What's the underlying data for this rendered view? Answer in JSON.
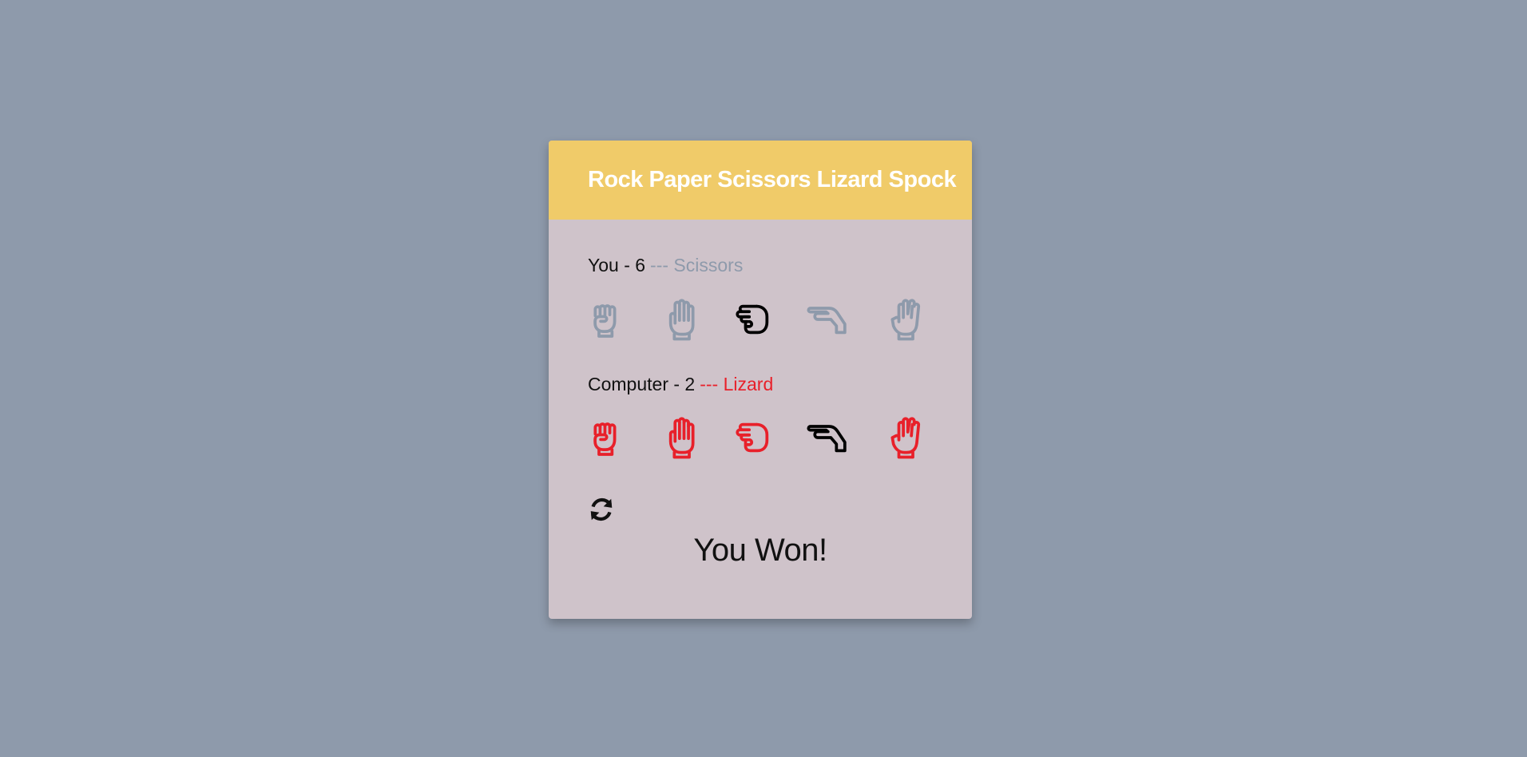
{
  "game": {
    "title": "Rock Paper Scissors Lizard Spock",
    "result": "You Won!"
  },
  "player": {
    "label": "You - 6",
    "separator": "---",
    "choice": "Scissors",
    "choice_color": "#8e9aab",
    "selected_index": 2,
    "icon_color": "#8e9aab",
    "selected_color": "#000000"
  },
  "computer": {
    "label": "Computer - 2",
    "separator": "---",
    "choice": "Lizard",
    "choice_color": "#e8202a",
    "selected_index": 3,
    "icon_color": "#e8202a",
    "selected_color": "#000000"
  },
  "hands": [
    {
      "name": "rock",
      "icon": "rock-hand-icon"
    },
    {
      "name": "paper",
      "icon": "paper-hand-icon"
    },
    {
      "name": "scissors",
      "icon": "scissors-hand-icon"
    },
    {
      "name": "lizard",
      "icon": "lizard-hand-icon"
    },
    {
      "name": "spock",
      "icon": "spock-hand-icon"
    }
  ],
  "colors": {
    "background": "#8e9aab",
    "header": "#f0cb69",
    "card": "#cfc3ca"
  },
  "controls": {
    "refresh_icon": "refresh-icon"
  }
}
